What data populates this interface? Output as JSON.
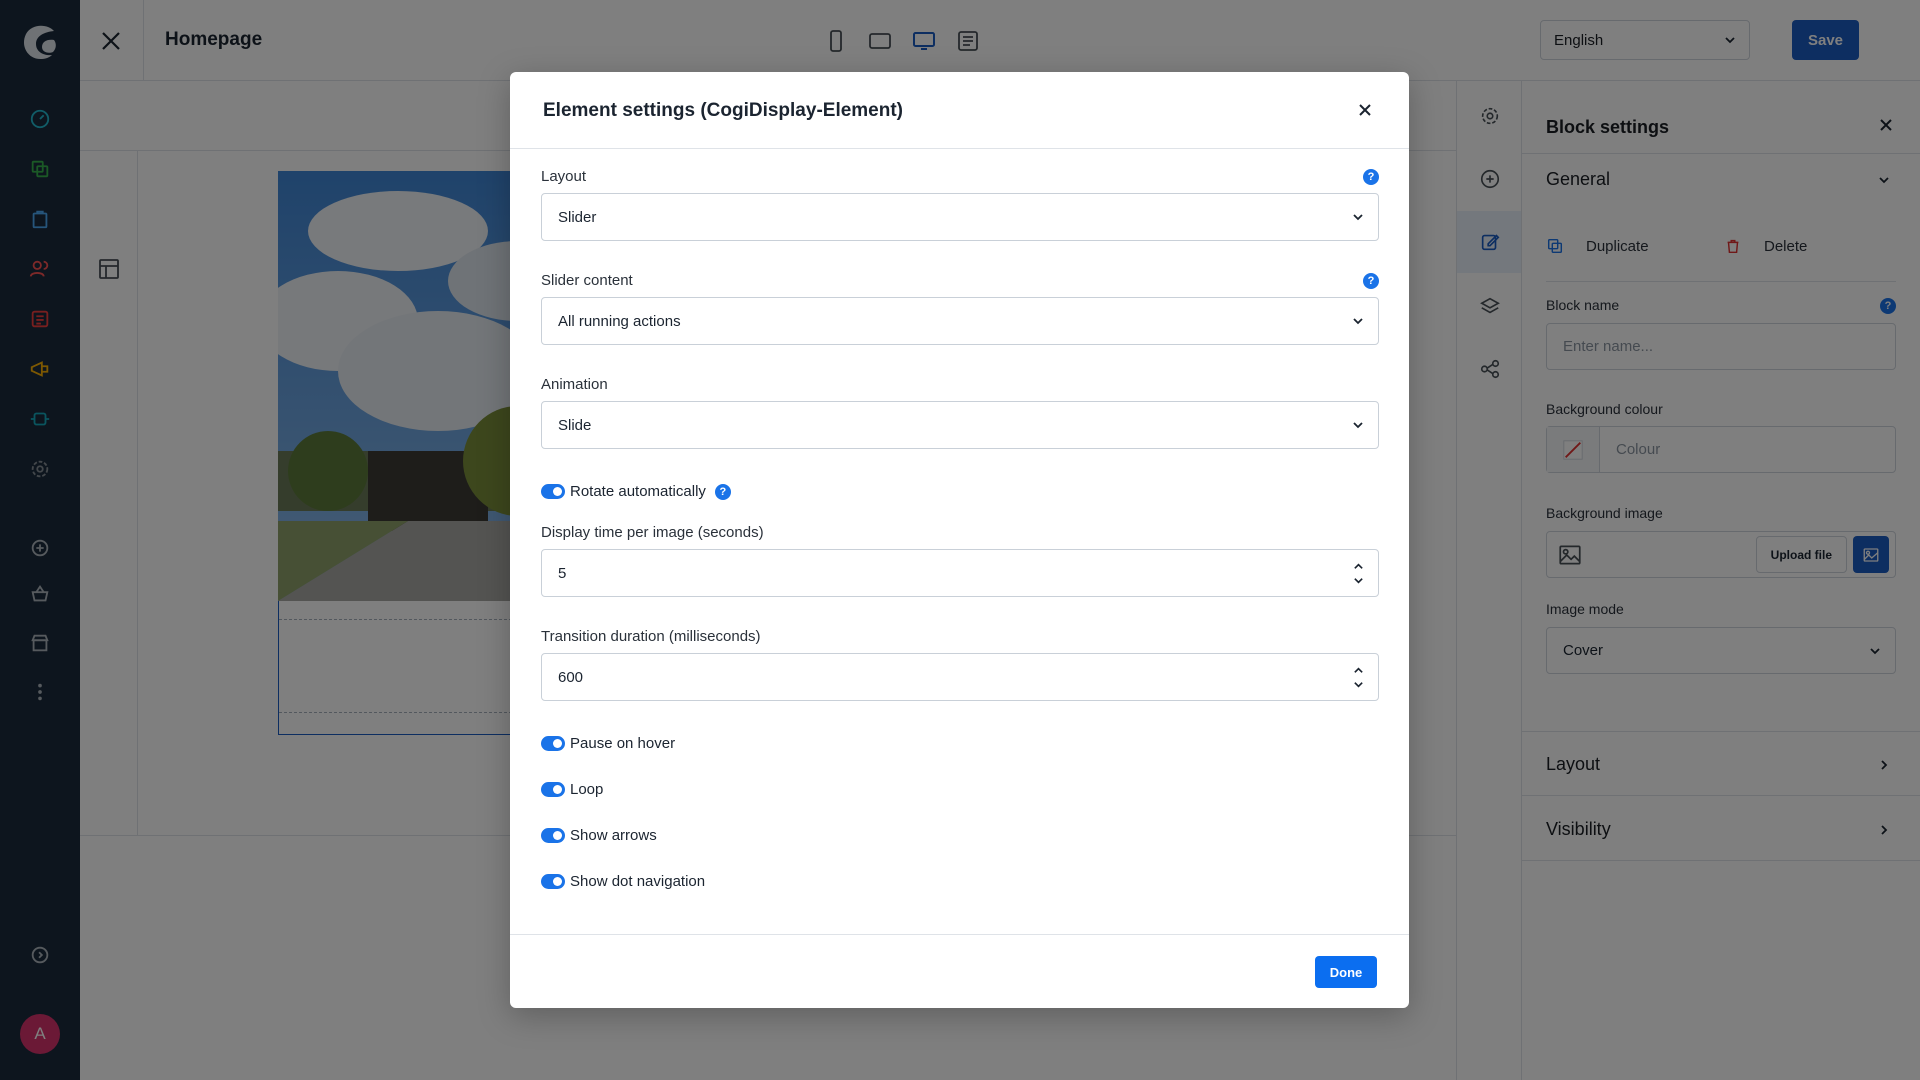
{
  "topbar": {
    "title": "Homepage",
    "language": "English",
    "save_label": "Save"
  },
  "user": {
    "avatar_initial": "A"
  },
  "block_panel": {
    "title": "Block settings",
    "general_label": "General",
    "duplicate_label": "Duplicate",
    "delete_label": "Delete",
    "block_name_label": "Block name",
    "block_name_placeholder": "Enter name...",
    "bg_colour_label": "Background colour",
    "bg_colour_placeholder": "Colour",
    "bg_image_label": "Background image",
    "upload_label": "Upload file",
    "image_mode_label": "Image mode",
    "image_mode_value": "Cover",
    "layout_label": "Layout",
    "visibility_label": "Visibility"
  },
  "modal": {
    "title": "Element settings (CogiDisplay-Element)",
    "layout_label": "Layout",
    "layout_value": "Slider",
    "slider_content_label": "Slider content",
    "slider_content_value": "All running actions",
    "animation_label": "Animation",
    "animation_value": "Slide",
    "rotate_label": "Rotate automatically",
    "display_time_label": "Display time per image (seconds)",
    "display_time_value": "5",
    "transition_label": "Transition duration (milliseconds)",
    "transition_value": "600",
    "pause_label": "Pause on hover",
    "loop_label": "Loop",
    "arrows_label": "Show arrows",
    "dots_label": "Show dot navigation",
    "done_label": "Done"
  },
  "colors": {
    "sidebar_bg": "#1a2b3c",
    "primary": "#1a5cc2",
    "toggle_on": "#1a73e8",
    "done_button": "#0b6ef0",
    "delete_icon": "#e03131"
  }
}
